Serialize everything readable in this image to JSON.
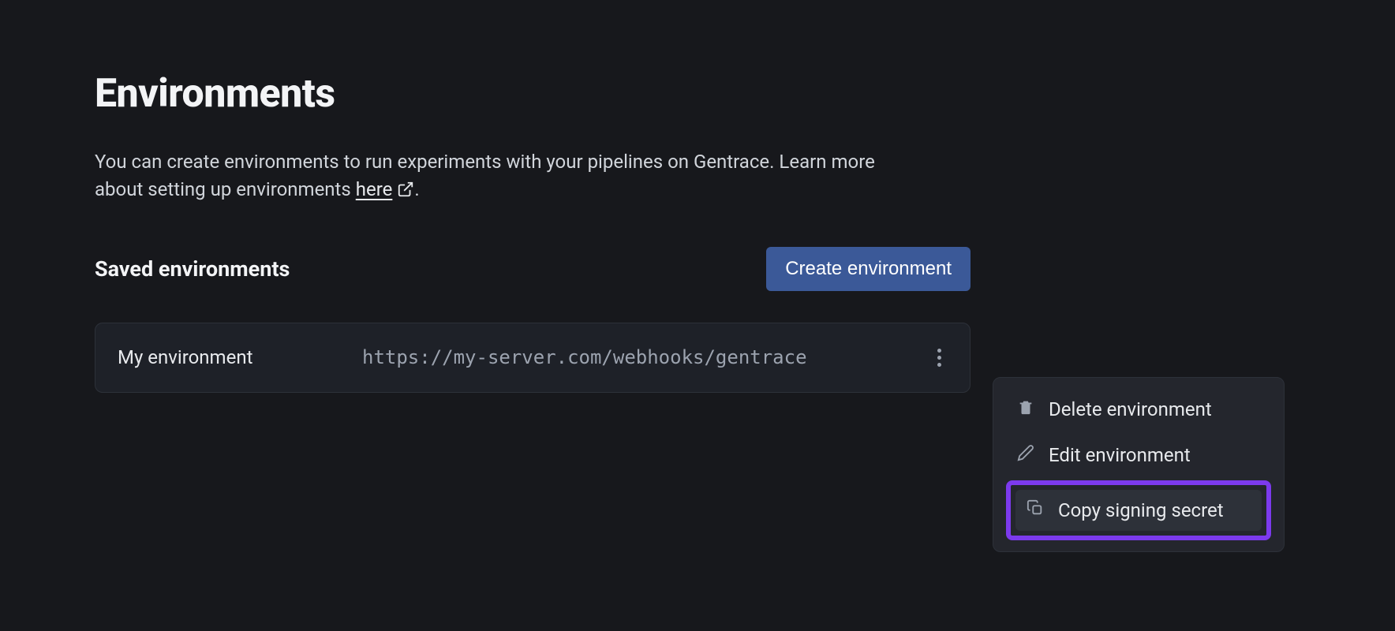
{
  "page": {
    "title": "Environments",
    "description_prefix": "You can create environments to run experiments with your pipelines on Gentrace. Learn more about setting up environments ",
    "description_link_text": "here",
    "description_suffix": "."
  },
  "section": {
    "title": "Saved environments",
    "create_button_label": "Create environment"
  },
  "environments": [
    {
      "name": "My environment",
      "url": "https://my-server.com/webhooks/gentrace"
    }
  ],
  "dropdown": {
    "delete_label": "Delete environment",
    "edit_label": "Edit environment",
    "copy_label": "Copy signing secret",
    "highlighted_item": "copy"
  },
  "icons": {
    "external": "external-link-icon",
    "kebab": "kebab-menu-icon",
    "trash": "trash-icon",
    "pencil": "pencil-icon",
    "copy": "copy-icon"
  }
}
